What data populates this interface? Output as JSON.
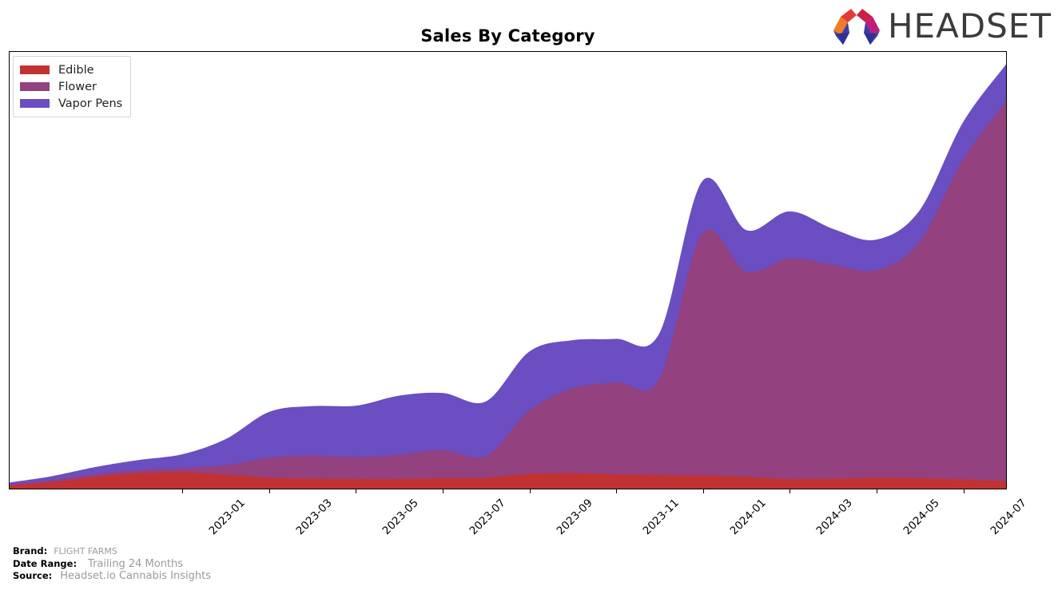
{
  "header": {
    "title": "Sales By Category",
    "logo": {
      "wordmark": "HEADSET",
      "mark_colors": [
        "#f07d22",
        "#e23b36",
        "#c5225a",
        "#c21b7a",
        "#3b3fa4",
        "#2e3192"
      ]
    }
  },
  "legend": {
    "position": "top-left",
    "items": [
      {
        "label": "Edible",
        "color": "#c33232"
      },
      {
        "label": "Flower",
        "color": "#93417f"
      },
      {
        "label": "Vapor Pens",
        "color": "#6a4ec2"
      }
    ]
  },
  "footer": {
    "rows": [
      {
        "key": "Brand:",
        "value": "FLIGHT FARMS"
      },
      {
        "key": "Date Range:",
        "value": "Trailing 24 Months"
      },
      {
        "key": "Source:",
        "value": "Headset.io Cannabis Insights"
      }
    ]
  },
  "chart_data": {
    "type": "area",
    "stacked": true,
    "interpolation": "smooth-spline",
    "title": "Sales By Category",
    "xlabel": "",
    "ylabel": "",
    "grid": false,
    "axis_y_ticks_visible": false,
    "legend_position": "top-left",
    "x": [
      "2022-09",
      "2022-10",
      "2022-11",
      "2022-12",
      "2023-01",
      "2023-02",
      "2023-03",
      "2023-04",
      "2023-05",
      "2023-06",
      "2023-07",
      "2023-08",
      "2023-09",
      "2023-10",
      "2023-11",
      "2023-12",
      "2024-01",
      "2024-02",
      "2024-03",
      "2024-04",
      "2024-05",
      "2024-06",
      "2024-07",
      "2024-08"
    ],
    "tick_labels": [
      "2023-01",
      "2023-03",
      "2023-05",
      "2023-07",
      "2023-09",
      "2023-11",
      "2024-01",
      "2024-03",
      "2024-05",
      "2024-07"
    ],
    "ylim": [
      0,
      100
    ],
    "series": [
      {
        "name": "Edible",
        "color": "#c33232",
        "values": [
          0.6,
          1.4,
          2.6,
          3.4,
          3.6,
          3.1,
          2.4,
          2.2,
          2.1,
          2.1,
          2.3,
          2.4,
          3.3,
          3.4,
          3.2,
          3.0,
          2.9,
          2.6,
          2.1,
          2.2,
          2.4,
          2.3,
          2.0,
          1.6
        ]
      },
      {
        "name": "Flower",
        "color": "#93417f",
        "values": [
          0.3,
          0.5,
          0.7,
          0.8,
          1.0,
          2.2,
          4.6,
          5.3,
          5.0,
          5.6,
          6.5,
          5.0,
          14.5,
          19.5,
          21.0,
          22.0,
          55.5,
          47.0,
          50.5,
          49.0,
          47.5,
          54.0,
          73.0,
          87.0
        ]
      },
      {
        "name": "Vapor Pens",
        "color": "#6a4ec2",
        "values": [
          0.4,
          0.9,
          1.6,
          2.3,
          3.2,
          6.0,
          10.5,
          11.3,
          11.8,
          13.5,
          13.0,
          12.5,
          13.5,
          11.0,
          10.0,
          10.4,
          12.0,
          9.5,
          10.8,
          8.2,
          7.0,
          7.2,
          8.6,
          8.4
        ]
      }
    ]
  }
}
